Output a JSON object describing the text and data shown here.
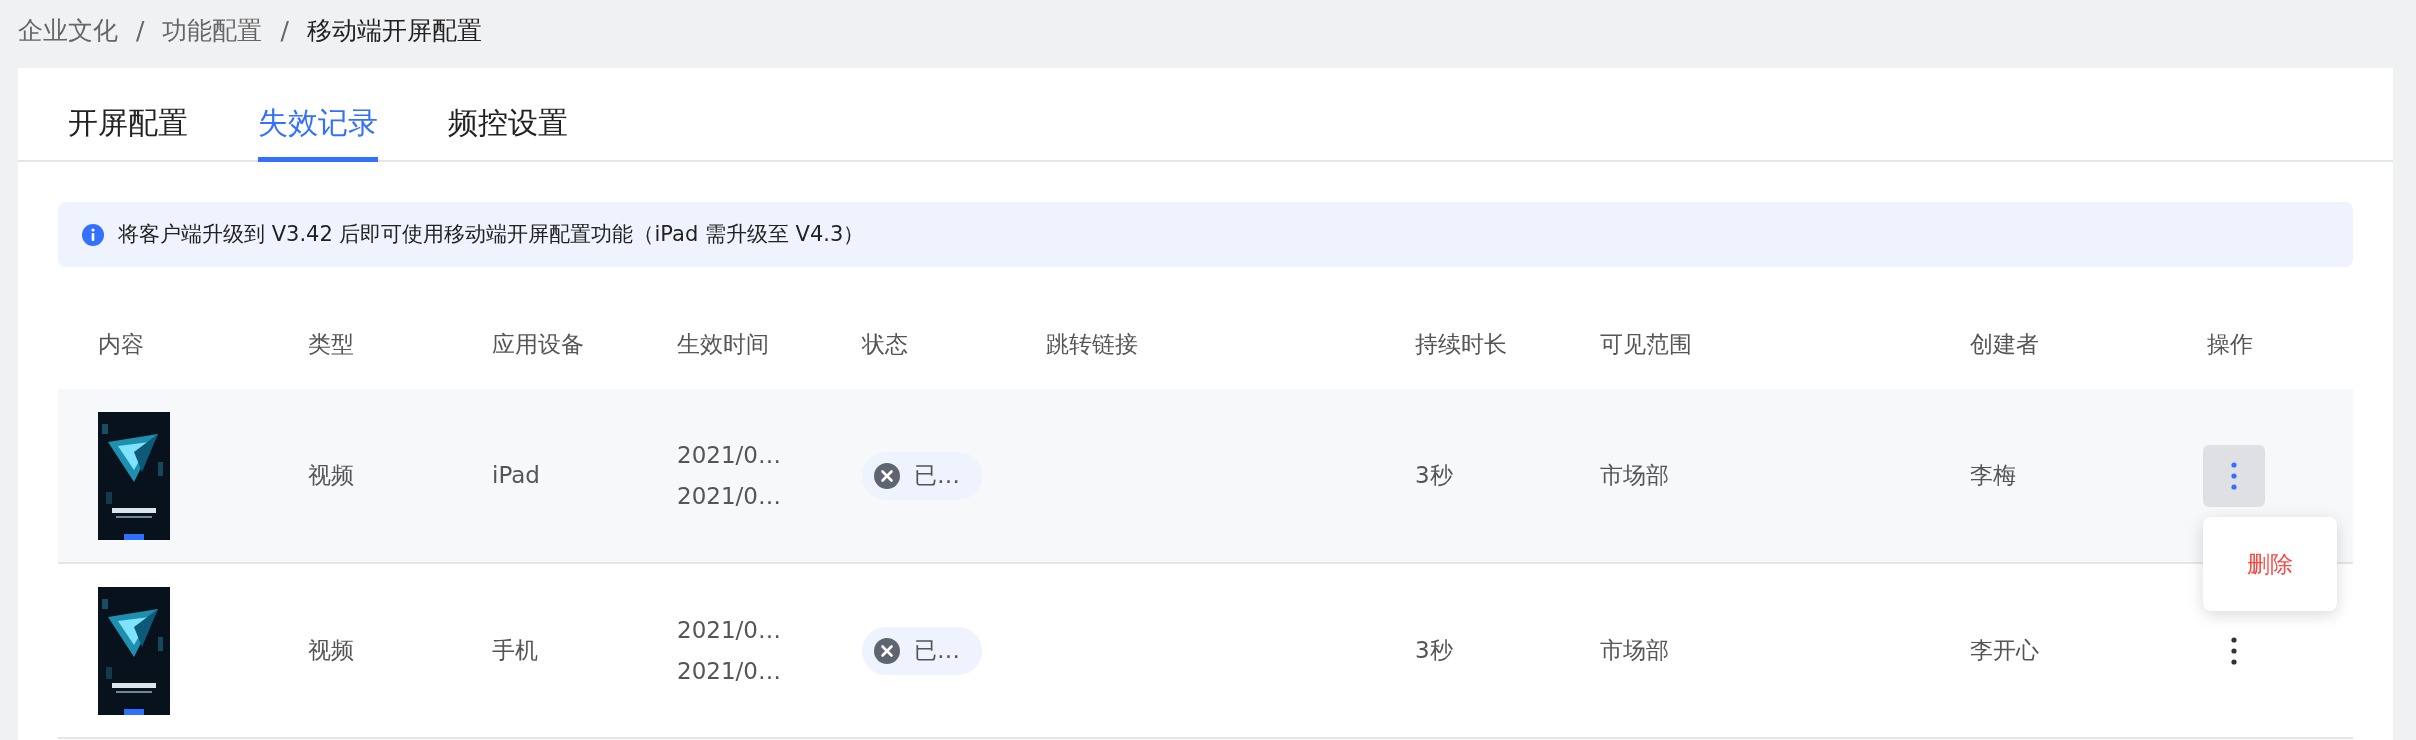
{
  "breadcrumb": [
    "企业文化",
    "功能配置",
    "移动端开屏配置"
  ],
  "breadcrumb_separator": "/",
  "tabs": [
    {
      "label": "开屏配置",
      "selected": false
    },
    {
      "label": "失效记录",
      "selected": true
    },
    {
      "label": "频控设置",
      "selected": false
    }
  ],
  "alert": {
    "kind": "info",
    "text": "将客户端升级到 V3.42 后即可使用移动端开屏配置功能（iPad 需升级至 V4.3）"
  },
  "table": {
    "columns": [
      "内容",
      "类型",
      "应用设备",
      "生效时间",
      "状态",
      "跳转链接",
      "持续时长",
      "可见范围",
      "创建者",
      "操作"
    ],
    "rows": [
      {
        "type": "视频",
        "device": "iPad",
        "start": "2021/0…",
        "end": "2021/0…",
        "status": {
          "kind": "expired",
          "text": "已…"
        },
        "duration": "3秒",
        "scope": "市场部",
        "creator": "李梅",
        "hovered": true,
        "menu": {
          "open": true,
          "items": [
            "删除"
          ]
        }
      },
      {
        "type": "视频",
        "device": "手机",
        "start": "2021/0…",
        "end": "2021/0…",
        "status": {
          "kind": "expired",
          "text": "已…"
        },
        "duration": "3秒",
        "scope": "市场部",
        "creator": "李开心",
        "hovered": false,
        "menu": {
          "open": false
        }
      }
    ]
  }
}
